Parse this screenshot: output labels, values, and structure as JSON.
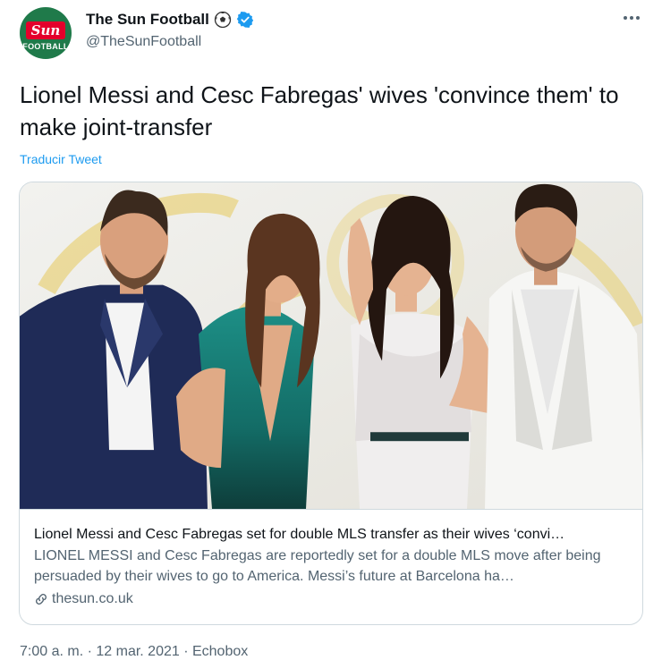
{
  "account": {
    "avatar_top": "Sun",
    "avatar_bottom": "FOOTBALL",
    "display_name": "The Sun Football",
    "handle": "@TheSunFootball"
  },
  "tweet": {
    "text": "Lionel Messi and Cesc Fabregas' wives 'convince them' to make joint-transfer",
    "translate_label": "Traducir Tweet"
  },
  "card": {
    "title": "Lionel Messi and Cesc Fabregas set for double MLS transfer as their wives ‘convi…",
    "description": "LIONEL MESSI and Cesc Fabregas are reportedly set for a double MLS move after being persuaded by their wives to go to America. Messi’s future at Barcelona ha…",
    "domain": "thesun.co.uk"
  },
  "meta": {
    "timestamp": "7:00 a. m. · 12 mar. 2021 · Echobox"
  },
  "colors": {
    "accent": "#1d9bf0",
    "secondary_text": "#536471",
    "border": "#cfd9de",
    "brand_red": "#e4002b"
  },
  "icons": [
    "soccer-ball-icon",
    "verified-badge-icon",
    "more-options-icon",
    "link-icon"
  ]
}
